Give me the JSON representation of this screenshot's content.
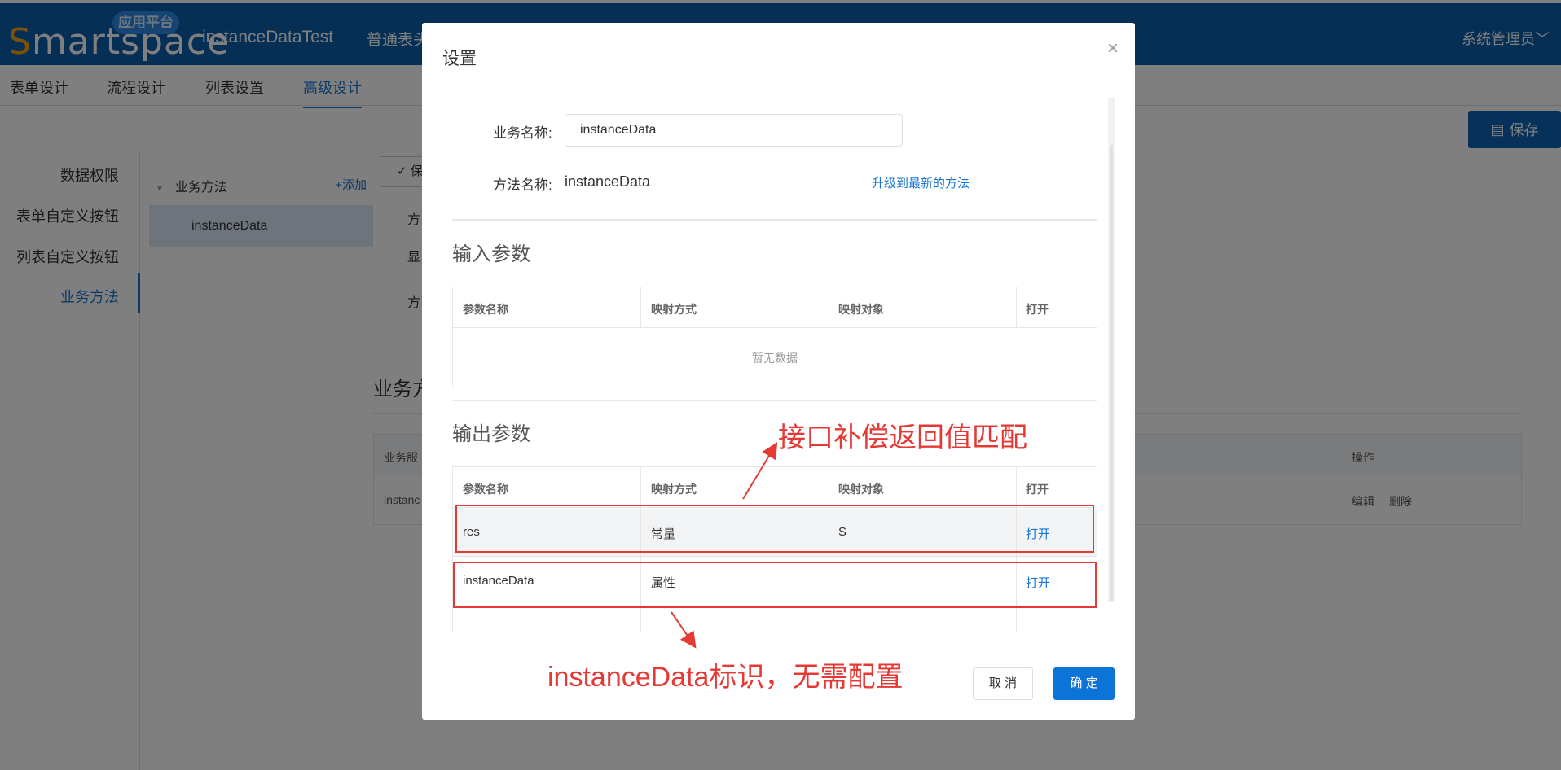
{
  "header": {
    "logo_text": "Smartspace",
    "logo_badge": "应用平台",
    "app_title": "instanceDataTest",
    "app_subtitle": "普通表头",
    "user": "系统管理员",
    "user_caret": "﹀"
  },
  "tabs": [
    "表单设计",
    "流程设计",
    "列表设置",
    "高级设计"
  ],
  "toolbar": {
    "save_label": "保存",
    "save_icon": "▤"
  },
  "left_nav": [
    "数据权限",
    "表单自定义按钮",
    "列表自定义按钮",
    "业务方法"
  ],
  "method_panel": {
    "title": "业务方法",
    "add_label": "+添加",
    "tree_caret": "▼",
    "items": [
      "instanceData"
    ]
  },
  "background": {
    "save_button_partial": "保",
    "check_mark": "✓",
    "labels_partial": [
      "方",
      "显",
      "方"
    ],
    "section_partial": "业务方",
    "table_header_partial": "业务服",
    "table_cell_partial": "instanc",
    "action_header": "操作",
    "action_edit": "编辑",
    "action_delete": "删除"
  },
  "modal": {
    "title": "设置",
    "close_icon": "×",
    "business_name_label": "业务名称:",
    "business_name_value": "instanceData",
    "method_name_label": "方法名称:",
    "method_name_value": "instanceData",
    "upgrade_link": "升级到最新的方法",
    "input_section_title": "输入参数",
    "output_section_title": "输出参数",
    "columns": [
      "参数名称",
      "映射方式",
      "映射对象",
      "打开"
    ],
    "empty_text": "暂无数据",
    "output_rows": [
      {
        "name": "res",
        "mapping": "常量",
        "target": "S",
        "action": "打开"
      },
      {
        "name": "instanceData",
        "mapping": "属性",
        "target": "",
        "action": "打开"
      }
    ],
    "cancel_label": "取 消",
    "ok_label": "确 定"
  },
  "annotations": {
    "top_note": "接口补偿返回值匹配",
    "bottom_note": "instanceData标识，无需配置",
    "color": "#e53935"
  }
}
